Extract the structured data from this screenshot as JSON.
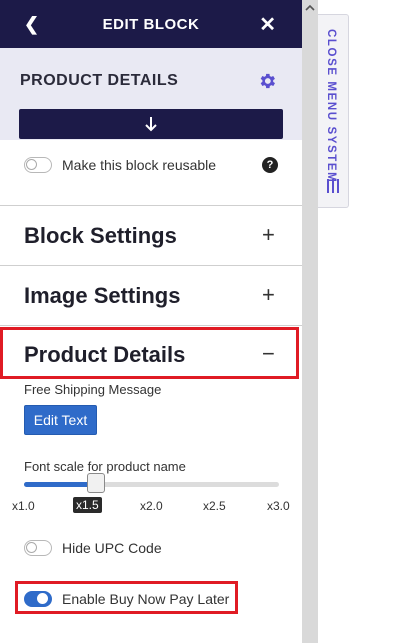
{
  "header": {
    "back_icon": "chevron-left",
    "title": "EDIT BLOCK",
    "close_icon": "close"
  },
  "block": {
    "name": "PRODUCT DETAILS",
    "settings_icon": "gear",
    "move_icon": "arrow-down"
  },
  "reusable": {
    "label": "Make this block reusable",
    "enabled": false,
    "help_icon": "question"
  },
  "sections": [
    {
      "title": "Block Settings",
      "toggle": "+"
    },
    {
      "title": "Image Settings",
      "toggle": "+"
    },
    {
      "title": "Product Details",
      "toggle": "−"
    }
  ],
  "product_details": {
    "shipping_label": "Free Shipping Message",
    "edit_button": "Edit Text",
    "font_scale_label": "Font scale for product name",
    "font_scale_ticks": [
      "x1.0",
      "x1.5",
      "x2.0",
      "x2.5",
      "x3.0"
    ],
    "font_scale_value": "x1.5",
    "hide_upc_label": "Hide UPC Code",
    "hide_upc_enabled": false,
    "bnpl_label": "Enable Buy Now Pay Later",
    "bnpl_enabled": true
  },
  "side_tab": {
    "label": "CLOSE MENU SYSTEM",
    "icon": "menu-bars"
  },
  "colors": {
    "header_bg": "#1c1a48",
    "accent": "#2f6bc9",
    "highlight": "#e01b24",
    "tab_text": "#5a4fcf"
  }
}
